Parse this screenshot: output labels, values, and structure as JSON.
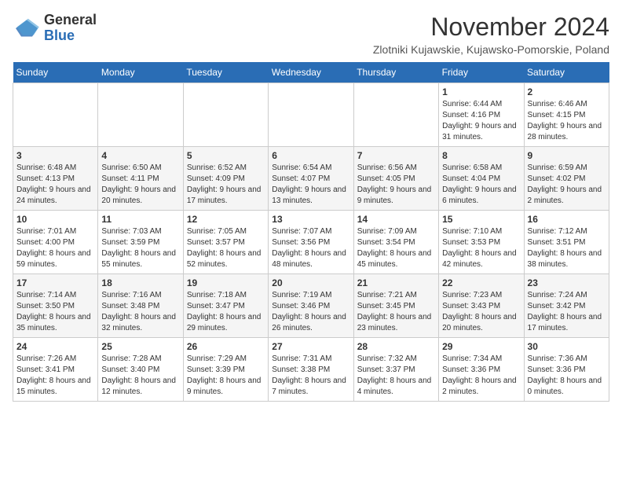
{
  "logo": {
    "general": "General",
    "blue": "Blue"
  },
  "title": "November 2024",
  "location": "Zlotniki Kujawskie, Kujawsko-Pomorskie, Poland",
  "days_of_week": [
    "Sunday",
    "Monday",
    "Tuesday",
    "Wednesday",
    "Thursday",
    "Friday",
    "Saturday"
  ],
  "weeks": [
    [
      {
        "day": "",
        "info": ""
      },
      {
        "day": "",
        "info": ""
      },
      {
        "day": "",
        "info": ""
      },
      {
        "day": "",
        "info": ""
      },
      {
        "day": "",
        "info": ""
      },
      {
        "day": "1",
        "info": "Sunrise: 6:44 AM\nSunset: 4:16 PM\nDaylight: 9 hours and 31 minutes."
      },
      {
        "day": "2",
        "info": "Sunrise: 6:46 AM\nSunset: 4:15 PM\nDaylight: 9 hours and 28 minutes."
      }
    ],
    [
      {
        "day": "3",
        "info": "Sunrise: 6:48 AM\nSunset: 4:13 PM\nDaylight: 9 hours and 24 minutes."
      },
      {
        "day": "4",
        "info": "Sunrise: 6:50 AM\nSunset: 4:11 PM\nDaylight: 9 hours and 20 minutes."
      },
      {
        "day": "5",
        "info": "Sunrise: 6:52 AM\nSunset: 4:09 PM\nDaylight: 9 hours and 17 minutes."
      },
      {
        "day": "6",
        "info": "Sunrise: 6:54 AM\nSunset: 4:07 PM\nDaylight: 9 hours and 13 minutes."
      },
      {
        "day": "7",
        "info": "Sunrise: 6:56 AM\nSunset: 4:05 PM\nDaylight: 9 hours and 9 minutes."
      },
      {
        "day": "8",
        "info": "Sunrise: 6:58 AM\nSunset: 4:04 PM\nDaylight: 9 hours and 6 minutes."
      },
      {
        "day": "9",
        "info": "Sunrise: 6:59 AM\nSunset: 4:02 PM\nDaylight: 9 hours and 2 minutes."
      }
    ],
    [
      {
        "day": "10",
        "info": "Sunrise: 7:01 AM\nSunset: 4:00 PM\nDaylight: 8 hours and 59 minutes."
      },
      {
        "day": "11",
        "info": "Sunrise: 7:03 AM\nSunset: 3:59 PM\nDaylight: 8 hours and 55 minutes."
      },
      {
        "day": "12",
        "info": "Sunrise: 7:05 AM\nSunset: 3:57 PM\nDaylight: 8 hours and 52 minutes."
      },
      {
        "day": "13",
        "info": "Sunrise: 7:07 AM\nSunset: 3:56 PM\nDaylight: 8 hours and 48 minutes."
      },
      {
        "day": "14",
        "info": "Sunrise: 7:09 AM\nSunset: 3:54 PM\nDaylight: 8 hours and 45 minutes."
      },
      {
        "day": "15",
        "info": "Sunrise: 7:10 AM\nSunset: 3:53 PM\nDaylight: 8 hours and 42 minutes."
      },
      {
        "day": "16",
        "info": "Sunrise: 7:12 AM\nSunset: 3:51 PM\nDaylight: 8 hours and 38 minutes."
      }
    ],
    [
      {
        "day": "17",
        "info": "Sunrise: 7:14 AM\nSunset: 3:50 PM\nDaylight: 8 hours and 35 minutes."
      },
      {
        "day": "18",
        "info": "Sunrise: 7:16 AM\nSunset: 3:48 PM\nDaylight: 8 hours and 32 minutes."
      },
      {
        "day": "19",
        "info": "Sunrise: 7:18 AM\nSunset: 3:47 PM\nDaylight: 8 hours and 29 minutes."
      },
      {
        "day": "20",
        "info": "Sunrise: 7:19 AM\nSunset: 3:46 PM\nDaylight: 8 hours and 26 minutes."
      },
      {
        "day": "21",
        "info": "Sunrise: 7:21 AM\nSunset: 3:45 PM\nDaylight: 8 hours and 23 minutes."
      },
      {
        "day": "22",
        "info": "Sunrise: 7:23 AM\nSunset: 3:43 PM\nDaylight: 8 hours and 20 minutes."
      },
      {
        "day": "23",
        "info": "Sunrise: 7:24 AM\nSunset: 3:42 PM\nDaylight: 8 hours and 17 minutes."
      }
    ],
    [
      {
        "day": "24",
        "info": "Sunrise: 7:26 AM\nSunset: 3:41 PM\nDaylight: 8 hours and 15 minutes."
      },
      {
        "day": "25",
        "info": "Sunrise: 7:28 AM\nSunset: 3:40 PM\nDaylight: 8 hours and 12 minutes."
      },
      {
        "day": "26",
        "info": "Sunrise: 7:29 AM\nSunset: 3:39 PM\nDaylight: 8 hours and 9 minutes."
      },
      {
        "day": "27",
        "info": "Sunrise: 7:31 AM\nSunset: 3:38 PM\nDaylight: 8 hours and 7 minutes."
      },
      {
        "day": "28",
        "info": "Sunrise: 7:32 AM\nSunset: 3:37 PM\nDaylight: 8 hours and 4 minutes."
      },
      {
        "day": "29",
        "info": "Sunrise: 7:34 AM\nSunset: 3:36 PM\nDaylight: 8 hours and 2 minutes."
      },
      {
        "day": "30",
        "info": "Sunrise: 7:36 AM\nSunset: 3:36 PM\nDaylight: 8 hours and 0 minutes."
      }
    ]
  ]
}
